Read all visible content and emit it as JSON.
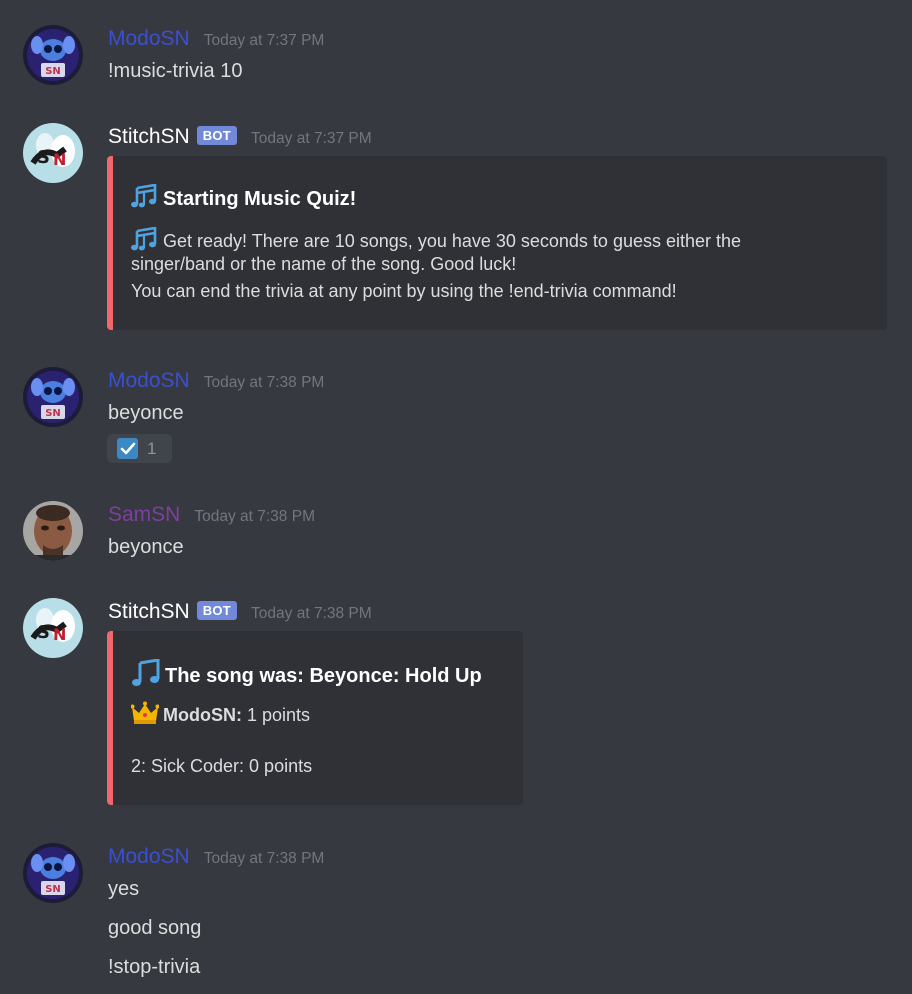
{
  "messages": [
    {
      "author": "ModoSN",
      "time": "Today at 7:37 PM",
      "lines": [
        "!music-trivia 10"
      ]
    },
    {
      "author": "StitchSN",
      "badge": "BOT",
      "time": "Today at 7:37 PM",
      "embed": {
        "title": "Starting Music Quiz!",
        "lines": [
          "Get ready! There are 10 songs, you have 30 seconds to guess either the",
          "singer/band or the name of the song. Good luck!",
          "You can end the trivia at any point by using the !end-trivia command!"
        ]
      }
    },
    {
      "author": "ModoSN",
      "time": "Today at 7:38 PM",
      "lines": [
        "beyonce"
      ],
      "reaction": {
        "emoji": "check-mark-icon",
        "count": "1"
      }
    },
    {
      "author": "SamSN",
      "time": "Today at 7:38 PM",
      "lines": [
        "beyonce"
      ]
    },
    {
      "author": "StitchSN",
      "badge": "BOT",
      "time": "Today at 7:38 PM",
      "embed": {
        "title": "The song was:  Beyonce: Hold Up",
        "winner_name": "ModoSN:",
        "winner_points": "1 points",
        "second_line": "2: Sick Coder: 0 points"
      }
    },
    {
      "author": "ModoSN",
      "time": "Today at 7:38 PM",
      "lines": [
        "yes",
        "good song",
        "!stop-trivia"
      ]
    }
  ],
  "colors": {
    "background": "#36393f",
    "embed_background": "#2f3136",
    "embed_accent": "#f0686b",
    "bot_badge": "#7289da",
    "modo_name": "#3b4fd3",
    "sam_name": "#7f3fa0",
    "timestamp": "#72767d"
  }
}
